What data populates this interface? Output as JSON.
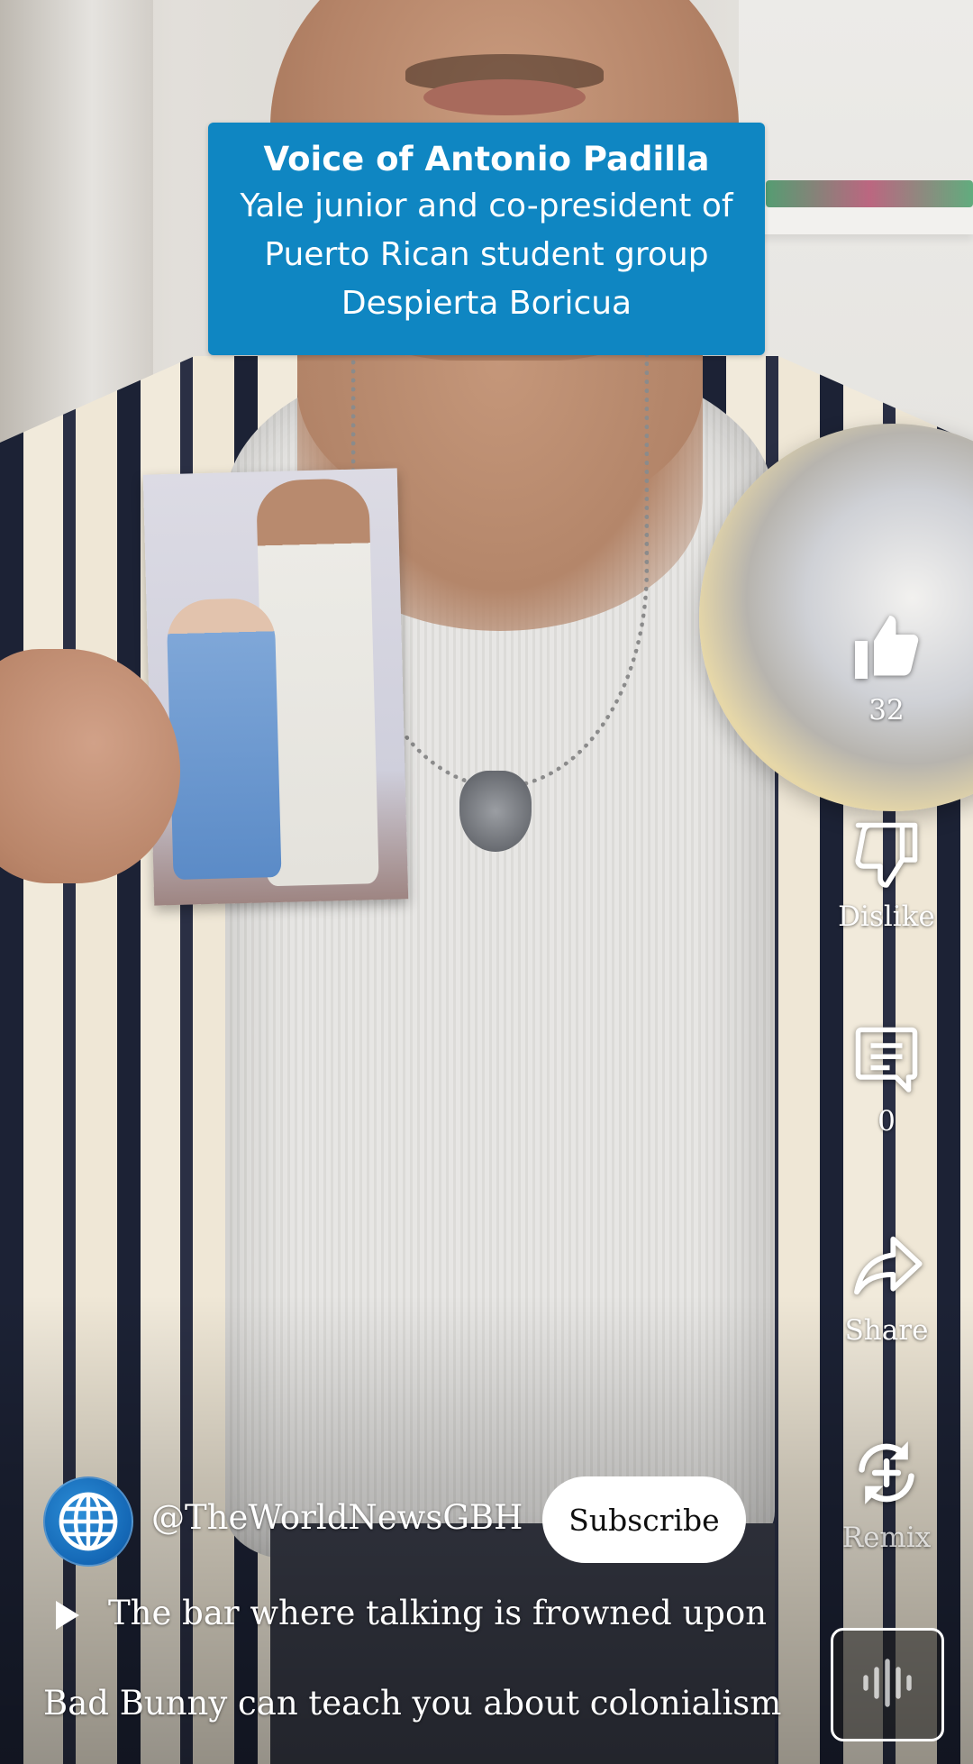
{
  "caption": {
    "name": "Voice of Antonio Padilla",
    "line1": "Yale junior and co-president of",
    "line2": "Puerto Rican student group",
    "line3": "Despierta Boricua"
  },
  "actions": {
    "like_count": "32",
    "dislike_label": "Dislike",
    "comment_count": "0",
    "share_label": "Share",
    "remix_label": "Remix"
  },
  "channel": {
    "handle": "@TheWorldNewsGBH",
    "subscribe_label": "Subscribe",
    "avatar_icon": "globe-icon"
  },
  "audio": {
    "title": "The bar where talking is frowned upon",
    "icon": "play-icon"
  },
  "video": {
    "title": "Bad Bunny can teach you about colonialism"
  },
  "colors": {
    "caption_bg": "#0f86c2",
    "subscribe_bg": "#ffffff"
  }
}
